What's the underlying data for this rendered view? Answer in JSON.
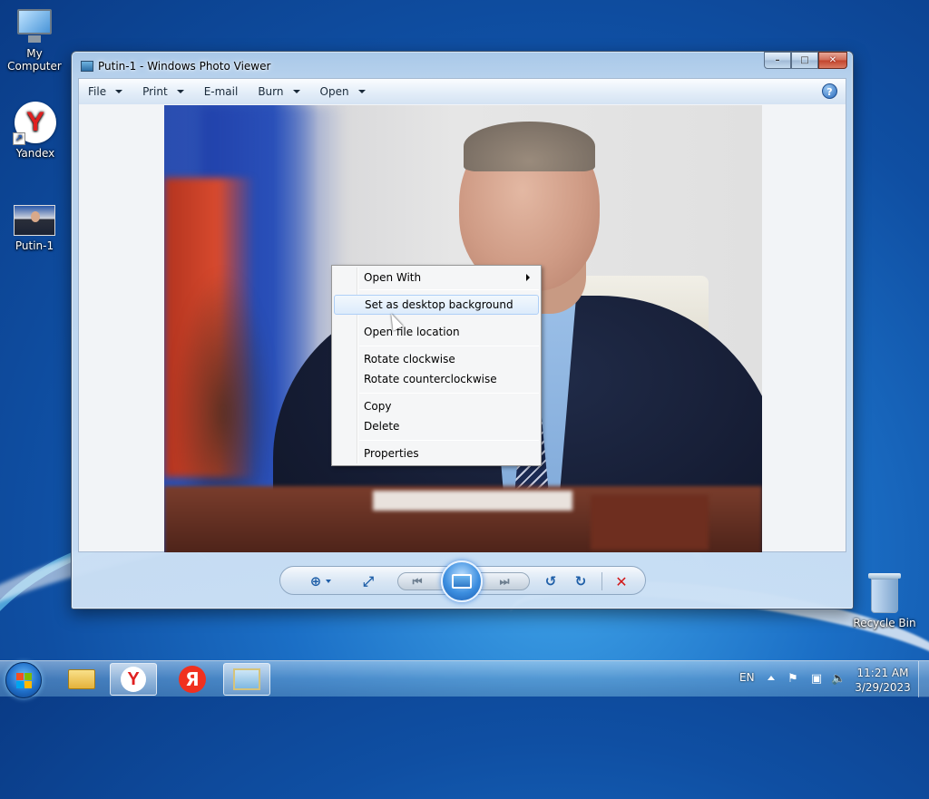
{
  "desktop": {
    "icons": [
      {
        "label": "My Computer"
      },
      {
        "label": "Yandex"
      },
      {
        "label": "Putin-1"
      },
      {
        "label": "Recycle Bin"
      }
    ]
  },
  "window": {
    "title": "Putin-1 - Windows Photo Viewer",
    "caption": {
      "minimize": "–",
      "maximize": "□",
      "close": "✕"
    },
    "menu": [
      {
        "label": "File",
        "has_dropdown": true
      },
      {
        "label": "Print",
        "has_dropdown": true
      },
      {
        "label": "E-mail",
        "has_dropdown": false
      },
      {
        "label": "Burn",
        "has_dropdown": true
      },
      {
        "label": "Open",
        "has_dropdown": true
      }
    ],
    "help": "?"
  },
  "context_menu": {
    "items": [
      {
        "label": "Open With",
        "has_submenu": true,
        "highlighted": false
      },
      {
        "label": "Set as desktop background",
        "highlighted": true
      },
      {
        "label": "Open file location",
        "highlighted": false
      },
      {
        "label": "Rotate clockwise",
        "highlighted": false
      },
      {
        "label": "Rotate counterclockwise",
        "highlighted": false
      },
      {
        "label": "Copy",
        "highlighted": false
      },
      {
        "label": "Delete",
        "highlighted": false
      },
      {
        "label": "Properties",
        "highlighted": false
      }
    ]
  },
  "navbar": {
    "zoom_icon": "⊕",
    "fit_icon": "⤢",
    "prev_icon": "⏮",
    "next_icon": "⏭",
    "rotate_ccw_icon": "↺",
    "rotate_cw_icon": "↻",
    "delete_icon": "✕"
  },
  "taskbar": {
    "language": "EN",
    "time": "11:21 AM",
    "date": "3/29/2023",
    "yandex_browser_glyph": "Y",
    "yandex_glyph": "Я"
  },
  "colors": {
    "accent": "#1f5fa8",
    "delete": "#d21a1a",
    "menu_highlight": "#dcebfb"
  }
}
